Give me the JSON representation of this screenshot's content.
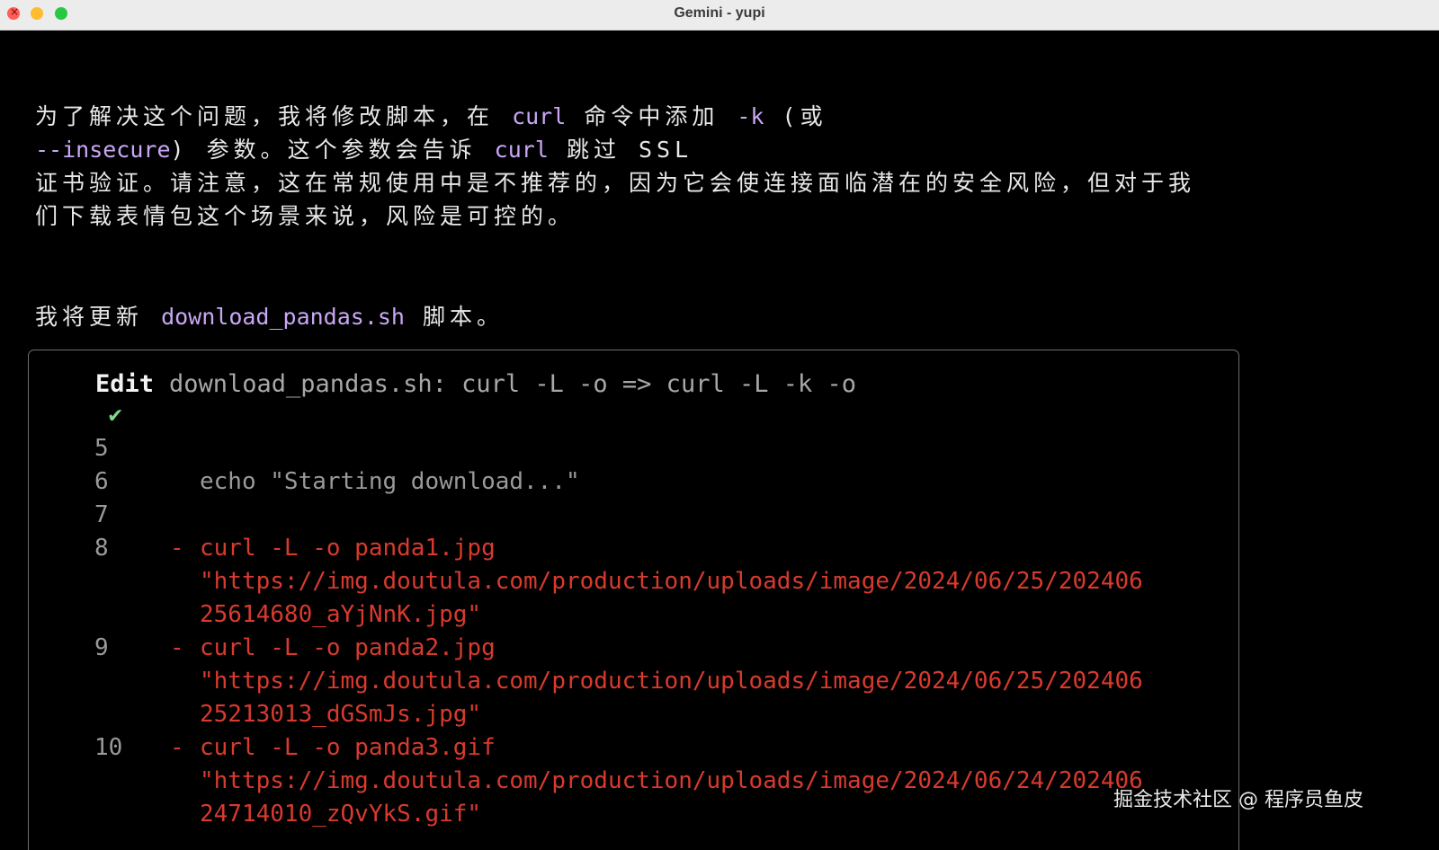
{
  "window": {
    "title": "Gemini - yupi"
  },
  "paragraph1": {
    "line1": {
      "a": "为了解决这个问题，我将修改脚本，在 ",
      "b": "curl",
      "c": " 命令中添加 ",
      "d": "-k",
      "e": " (或"
    },
    "line2": {
      "a": "--insecure",
      "b": ") 参数。这个参数会告诉 ",
      "c": "curl",
      "d": " 跳过 SSL"
    },
    "line3": "证书验证。请注意，这在常规使用中是不推荐的，因为它会使连接面临潜在的安全风险，但对于我",
    "line4": "们下载表情包这个场景来说，风险是可控的。"
  },
  "paragraph2": {
    "a": "我将更新 ",
    "b": "download_pandas.sh",
    "c": " 脚本。"
  },
  "edit": {
    "check": "✔",
    "label": "Edit",
    "description": "download_pandas.sh: curl -L -o => curl -L -k -o",
    "rows": [
      {
        "num": "5",
        "mark": "",
        "text": "",
        "removed": false
      },
      {
        "num": "6",
        "mark": "",
        "text": "echo \"Starting download...\"",
        "removed": false
      },
      {
        "num": "7",
        "mark": "",
        "text": "",
        "removed": false
      },
      {
        "num": "8",
        "mark": "-",
        "text": "curl -L -o panda1.jpg",
        "removed": true
      },
      {
        "num": "",
        "mark": "",
        "text": "\"https://img.doutula.com/production/uploads/image/2024/06/25/202406",
        "removed": true
      },
      {
        "num": "",
        "mark": "",
        "text": "25614680_aYjNnK.jpg\"",
        "removed": true
      },
      {
        "num": "9",
        "mark": "-",
        "text": "curl -L -o panda2.jpg",
        "removed": true
      },
      {
        "num": "",
        "mark": "",
        "text": "\"https://img.doutula.com/production/uploads/image/2024/06/25/202406",
        "removed": true
      },
      {
        "num": "",
        "mark": "",
        "text": "25213013_dGSmJs.jpg\"",
        "removed": true
      },
      {
        "num": "10",
        "mark": "-",
        "text": "curl -L -o panda3.gif",
        "removed": true
      },
      {
        "num": "",
        "mark": "",
        "text": "\"https://img.doutula.com/production/uploads/image/2024/06/24/202406",
        "removed": true
      },
      {
        "num": "",
        "mark": "",
        "text": "24714010_zQvYkS.gif\"",
        "removed": true
      }
    ]
  },
  "watermark": "掘金技术社区 @ 程序员鱼皮"
}
